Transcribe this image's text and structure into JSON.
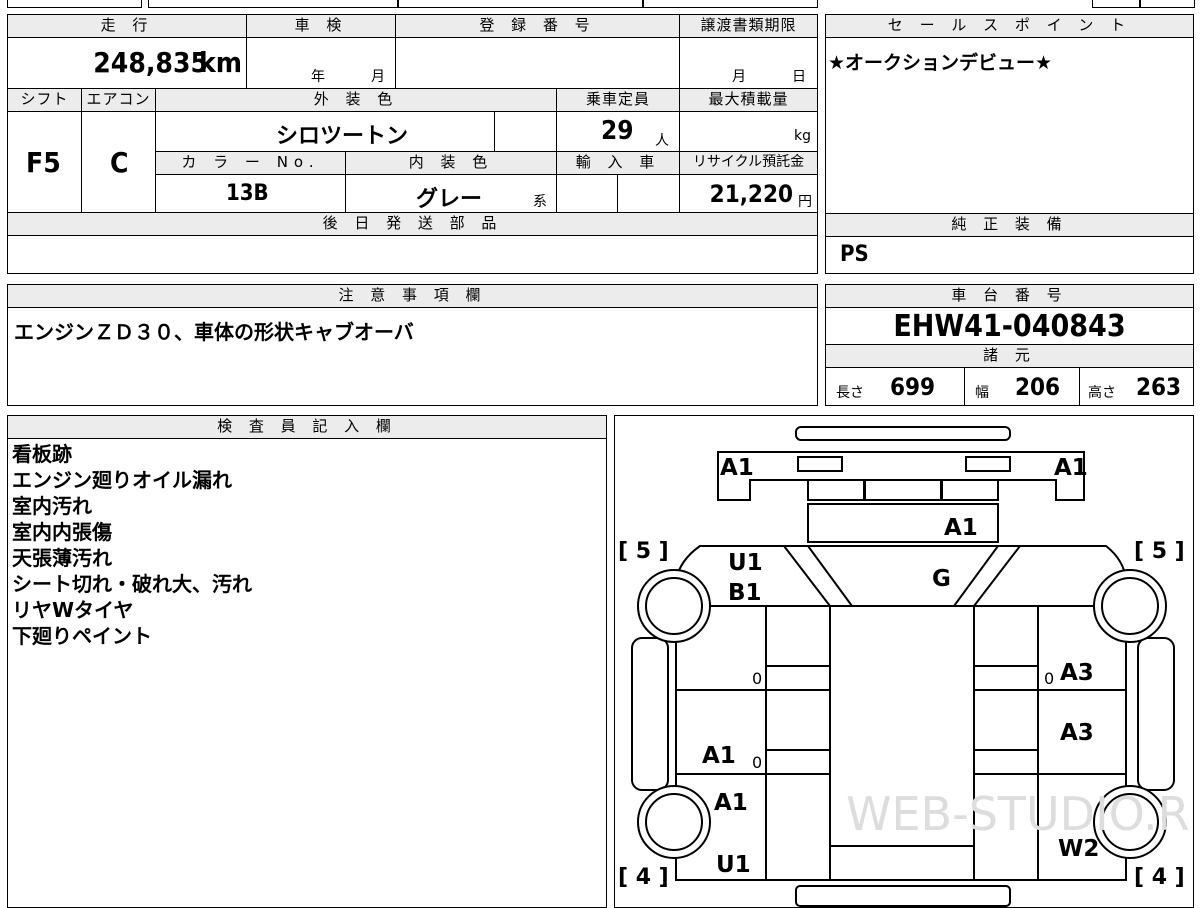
{
  "summary": {
    "mileage_header": "走 行",
    "mileage_value": "248,835",
    "mileage_unit": "km",
    "inspection_header": "車 検",
    "inspection_year_unit": "年",
    "inspection_month_unit": "月",
    "registration_header": "登 録 番 号",
    "registration_value": "",
    "transfer_header": "譲渡書類期限",
    "transfer_month_unit": "月",
    "transfer_day_unit": "日"
  },
  "specs": {
    "shift_header": "シフト",
    "shift_value": "F5",
    "ac_header": "エアコン",
    "ac_value": "C",
    "exterior_color_header": "外 装 色",
    "exterior_color_value": "シロツートン",
    "capacity_header": "乗車定員",
    "capacity_value": "29",
    "capacity_unit": "人",
    "max_load_header": "最大積載量",
    "max_load_unit": "kg",
    "color_no_header": "カ ラ ー No.",
    "color_no_value": "13B",
    "interior_color_header": "内 装 色",
    "interior_color_value": "グレー",
    "interior_color_suffix": "系",
    "import_header": "輸 入 車",
    "recycle_header": "リサイクル預託金",
    "recycle_value": "21,220",
    "recycle_unit": "円"
  },
  "later_parts": {
    "header": "後 日 発 送 部 品",
    "value": ""
  },
  "sales_points": {
    "header": "セ ー ル ス ポ イ ン ト",
    "value": "★オークションデビュー★"
  },
  "genuine_equipment": {
    "header": "純 正 装 備",
    "value": "PS"
  },
  "caution": {
    "header": "注 意 事 項 欄",
    "value": "エンジンＺＤ３０、車体の形状キャブオーバ"
  },
  "chassis": {
    "header": "車 台 番 号",
    "value": "EHW41-040843",
    "dimensions_header": "諸 元",
    "length_label": "長さ",
    "length_value": "699",
    "width_label": "幅",
    "width_value": "206",
    "height_label": "高さ",
    "height_value": "263"
  },
  "inspector": {
    "header": "検 査 員 記 入 欄",
    "lines": [
      "看板跡",
      "エンジン廻りオイル漏れ",
      "室内汚れ",
      "室内内張傷",
      "天張薄汚れ",
      "シート切れ・破れ大、汚れ",
      "リヤWタイヤ",
      "下廻りペイント"
    ]
  },
  "diagram": {
    "marks": {
      "front_left_mirror": "A1",
      "front_right_mirror": "A1",
      "grille": "A1",
      "front_left_upper_1": "U1",
      "front_left_upper_2": "B1",
      "windshield": "G",
      "left_small_1": "0",
      "left_mid": "A1",
      "left_small_2": "0",
      "left_rear": "A1",
      "left_bottom": "U1",
      "right_small": "0",
      "right_upper": "A3",
      "right_mid": "A3",
      "right_bottom": "W2"
    },
    "tyre_front_left": "[ 5 ]",
    "tyre_front_right": "[ 5 ]",
    "tyre_rear_left": "[ 4 ]",
    "tyre_rear_right": "[ 4 ]",
    "watermark": "WEB-STUDIO.RU"
  }
}
